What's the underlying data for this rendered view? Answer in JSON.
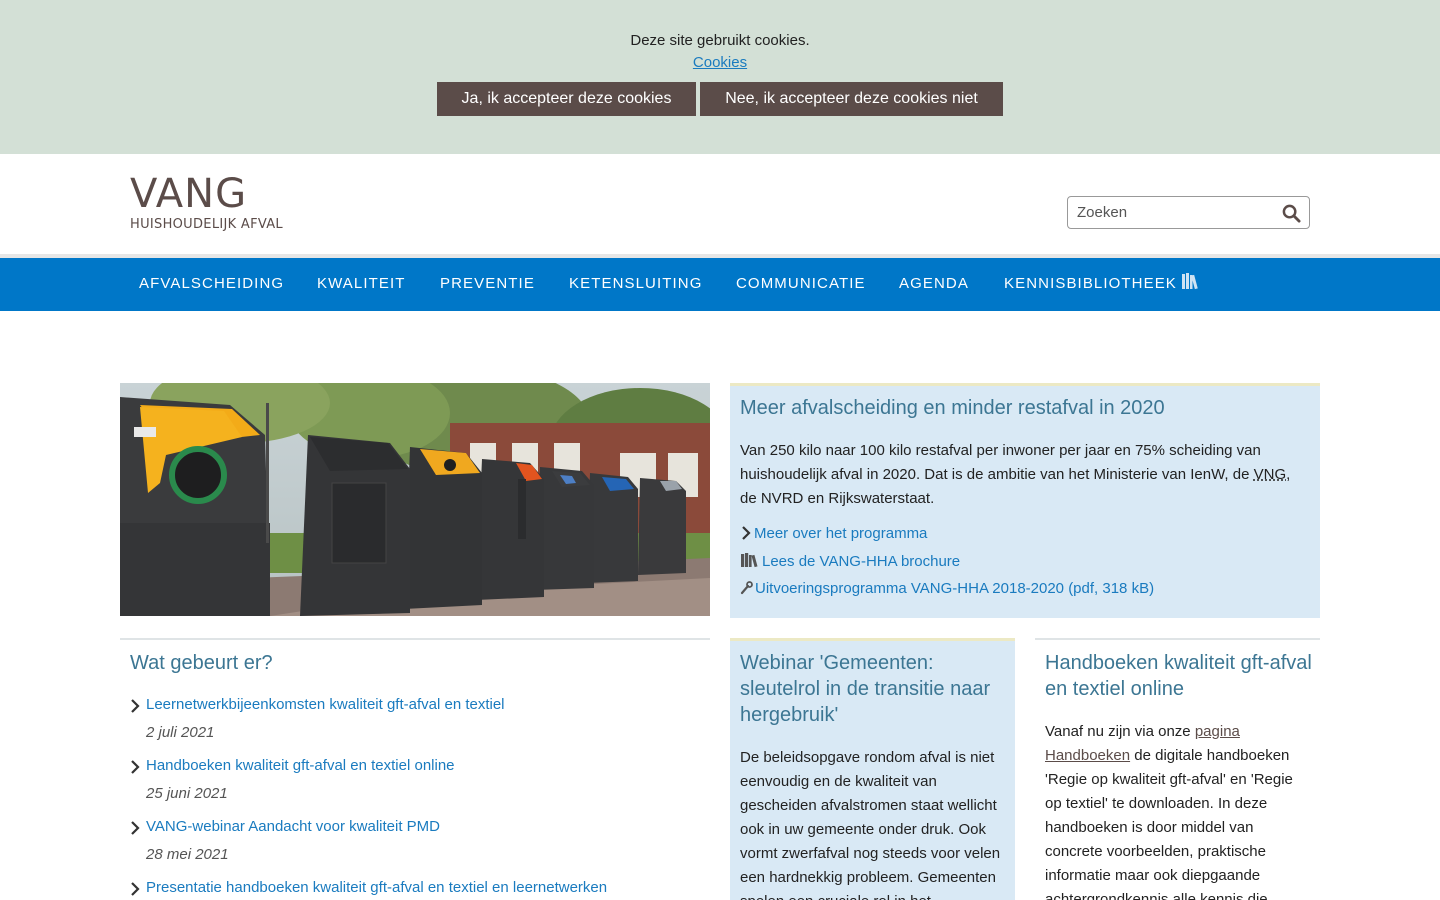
{
  "cookie_bar": {
    "message": "Deze site gebruikt cookies.",
    "link_label": "Cookies",
    "accept_label": "Ja, ik accepteer deze cookies",
    "decline_label": "Nee, ik accepteer deze cookies niet"
  },
  "header": {
    "logo_main": "VANG",
    "logo_sub": "HUISHOUDELIJK AFVAL",
    "search_placeholder": "Zoeken"
  },
  "nav": {
    "items": [
      {
        "label": "AFVALSCHEIDING"
      },
      {
        "label": "KWALITEIT"
      },
      {
        "label": "PREVENTIE"
      },
      {
        "label": "KETENSLUITING"
      },
      {
        "label": "COMMUNICATIE"
      },
      {
        "label": "AGENDA"
      },
      {
        "label": "KENNISBIBLIOTHEEK",
        "icon": "books-icon"
      }
    ]
  },
  "intro": {
    "title": "Meer afvalscheiding en minder restafval in 2020",
    "text_before": "Van 250 kilo naar 100 kilo restafval per inwoner per jaar en 75% scheiding van huishoudelijk afval in 2020. Dat is de ambitie van het Ministerie van IenW, de ",
    "abbr": "VNG",
    "text_after": ", de NVRD en Rijkswaterstaat.",
    "links": [
      {
        "label": "Meer over het programma",
        "icon": "chevron-right-icon"
      },
      {
        "label": "Lees de VANG-HHA brochure",
        "icon": "books-icon"
      },
      {
        "label": "Uitvoeringsprogramma VANG-HHA 2018-2020 (pdf, 318 kB)",
        "icon": "wrench-icon"
      }
    ]
  },
  "news": {
    "title": "Wat gebeurt er?",
    "items": [
      {
        "title": "Leernetwerkbijeenkomsten kwaliteit gft-afval en textiel",
        "date": "2 juli 2021"
      },
      {
        "title": "Handboeken kwaliteit gft-afval en textiel online",
        "date": "25 juni 2021"
      },
      {
        "title": "VANG-webinar Aandacht voor kwaliteit PMD",
        "date": "28 mei 2021"
      },
      {
        "title": "Presentatie handboeken kwaliteit gft-afval en textiel en leernetwerken",
        "date": ""
      }
    ]
  },
  "webinar": {
    "title": "Webinar 'Gemeenten: sleutelrol in de transitie naar hergebruik'",
    "text": "De beleidsopgave rondom afval is niet eenvoudig en de kwaliteit van gescheiden afvalstromen staat wellicht ook in uw gemeente onder druk. Ook vormt zwerfafval nog steeds voor velen een hardnekkig probleem. Gemeenten spelen een cruciale rol in het"
  },
  "handboeken": {
    "title": "Handboeken kwaliteit gft-afval en textiel online",
    "text_before": "Vanaf nu zijn via onze ",
    "link": "pagina Handboeken",
    "text_after": " de digitale handboeken 'Regie op kwaliteit gft-afval' en 'Regie op textiel' te downloaden. In deze handboeken is door middel van concrete voorbeelden, praktische informatie maar ook diepgaande achtergrondkennis alle kennis die"
  },
  "colors": {
    "cookie_bg": "#d3e0d6",
    "button_bg": "#5b4c49",
    "nav_bg": "#0077c8",
    "link": "#1a7bbf",
    "box_bg": "#d9e9f5",
    "heading": "#3c7693"
  }
}
